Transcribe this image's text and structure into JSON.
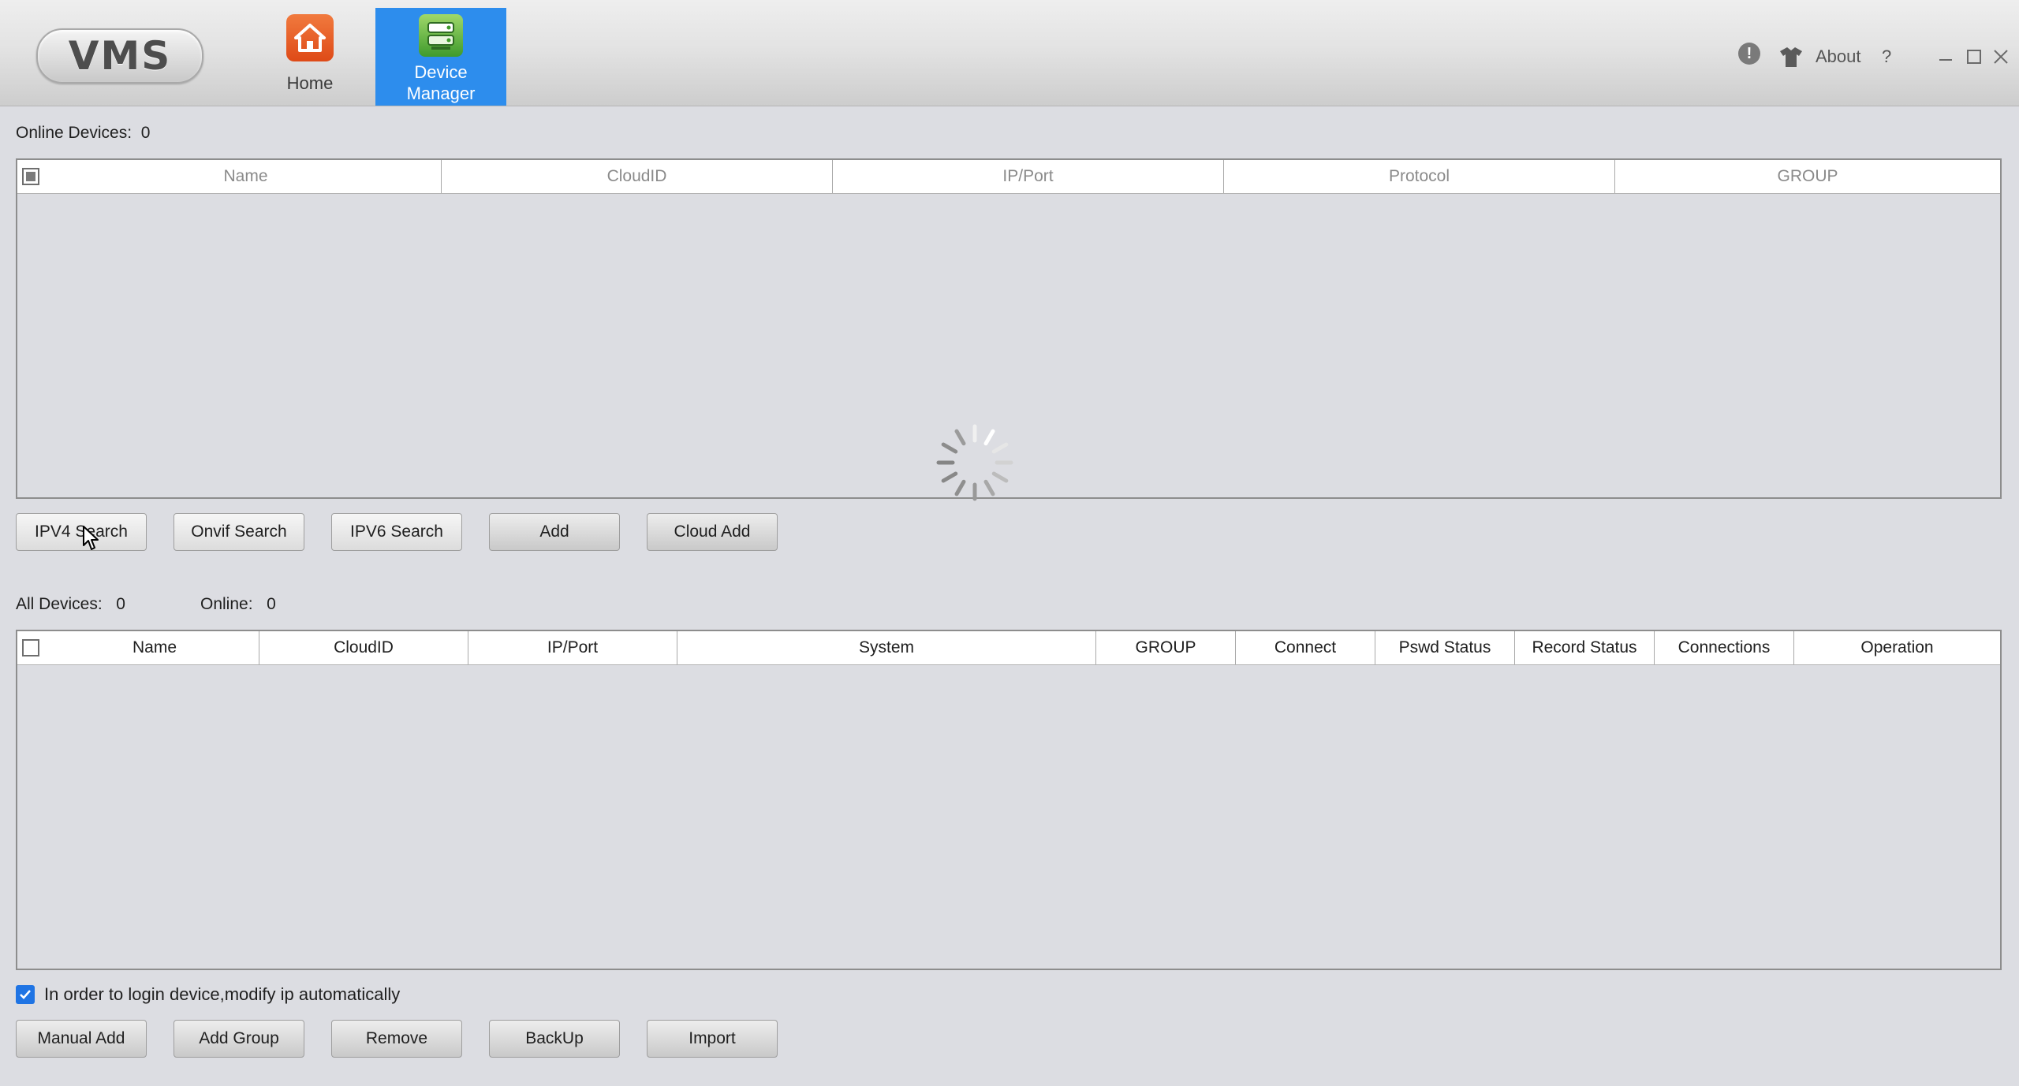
{
  "app": {
    "logo_text": "VMS",
    "nav": [
      {
        "label_line1": "Home",
        "label_line2": "",
        "icon": "home-icon",
        "active": false
      },
      {
        "label_line1": "Device",
        "label_line2": "Manager",
        "icon": "device-manager-icon",
        "active": true
      }
    ],
    "header_right": {
      "alert_icon": "exclamation-icon",
      "alert_glyph": "!",
      "skin_icon": "shirt-icon",
      "about_label": "About",
      "help_label": "?"
    }
  },
  "online_section": {
    "count_label": "Online Devices:",
    "count_value": "0",
    "columns": [
      "Name",
      "CloudID",
      "IP/Port",
      "Protocol",
      "GROUP"
    ],
    "loading": true,
    "buttons": [
      "IPV4 Search",
      "Onvif Search",
      "IPV6 Search",
      "Add",
      "Cloud Add"
    ]
  },
  "device_section": {
    "all_label": "All Devices:",
    "all_value": "0",
    "online_label": "Online:",
    "online_value": "0",
    "columns": [
      "Name",
      "CloudID",
      "IP/Port",
      "System",
      "GROUP",
      "Connect",
      "Pswd Status",
      "Record Status",
      "Connections",
      "Operation"
    ],
    "auto_ip_checkbox": {
      "label": "In order to login device,modify ip automatically",
      "checked": true
    },
    "buttons": [
      "Manual Add",
      "Add Group",
      "Remove",
      "BackUp",
      "Import"
    ]
  },
  "colors": {
    "active_tab": "#2d8ded",
    "background": "#dcdde2",
    "checkbox_checked": "#1f74e4"
  }
}
